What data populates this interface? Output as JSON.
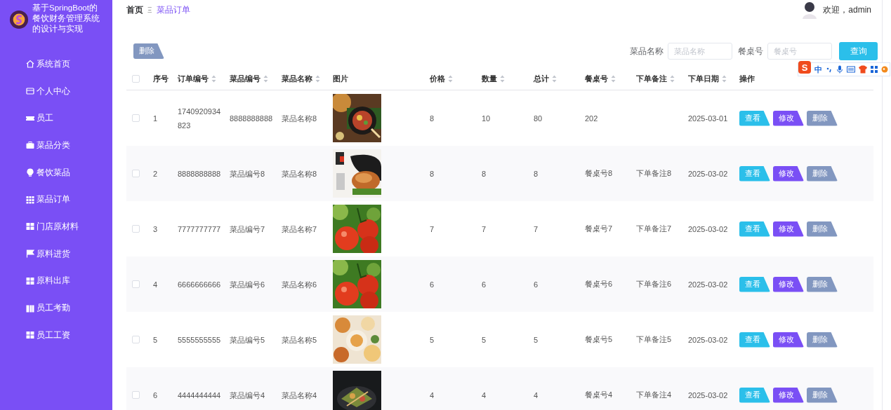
{
  "sidebar": {
    "title": "基于SpringBoot的餐饮财务管理系统的设计与实现",
    "menu": [
      {
        "label": "系统首页"
      },
      {
        "label": "个人中心"
      },
      {
        "label": "员工"
      },
      {
        "label": "菜品分类"
      },
      {
        "label": "餐饮菜品"
      },
      {
        "label": "菜品订单"
      },
      {
        "label": "门店原材料"
      },
      {
        "label": "原料进货"
      },
      {
        "label": "原料出库"
      },
      {
        "label": "员工考勤"
      },
      {
        "label": "员工工资"
      }
    ]
  },
  "breadcrumb": {
    "home": "首页",
    "separator": "Ξ",
    "current": "菜品订单"
  },
  "user": {
    "greeting": "欢迎，admin"
  },
  "toolbar": {
    "delete_button": "删除",
    "filters": [
      {
        "label": "菜品名称",
        "placeholder": "菜品名称"
      },
      {
        "label": "餐桌号",
        "placeholder": "餐桌号"
      }
    ],
    "search_button": "查询"
  },
  "ime": {
    "logo": "S",
    "mode": "中"
  },
  "table": {
    "select_all_checked": false,
    "columns": [
      {
        "label": "序号",
        "sortable": false
      },
      {
        "label": "订单编号",
        "sortable": true
      },
      {
        "label": "菜品编号",
        "sortable": true
      },
      {
        "label": "菜品名称",
        "sortable": true
      },
      {
        "label": "图片",
        "sortable": false
      },
      {
        "label": "价格",
        "sortable": true
      },
      {
        "label": "数量",
        "sortable": true
      },
      {
        "label": "总计",
        "sortable": true
      },
      {
        "label": "餐桌号",
        "sortable": true
      },
      {
        "label": "下单备注",
        "sortable": true
      },
      {
        "label": "下单日期",
        "sortable": true
      },
      {
        "label": "操作",
        "sortable": false
      }
    ],
    "rows": [
      {
        "checked": false,
        "index": "1",
        "order_no": "1740920934823",
        "dish_no": "8888888888",
        "dish_name": "菜品名称8",
        "price": "8",
        "quantity": "10",
        "total": "80",
        "table_no": "202",
        "order_date": "2025-03-01",
        "actions": [
          "查看",
          "修改",
          "删除"
        ]
      },
      {
        "checked": false,
        "index": "2",
        "order_no": "8888888888",
        "dish_no": "菜品编号8",
        "dish_name": "菜品名称8",
        "price": "8",
        "quantity": "8",
        "total": "8",
        "table_no": "餐桌号8",
        "remark": "下单备注8",
        "order_date": "2025-03-02",
        "actions": [
          "查看",
          "修改",
          "删除"
        ]
      },
      {
        "checked": false,
        "index": "3",
        "order_no": "7777777777",
        "dish_no": "菜品编号7",
        "dish_name": "菜品名称7",
        "price": "7",
        "quantity": "7",
        "total": "7",
        "table_no": "餐桌号7",
        "remark": "下单备注7",
        "order_date": "2025-03-02",
        "actions": [
          "查看",
          "修改",
          "删除"
        ]
      },
      {
        "checked": false,
        "index": "4",
        "order_no": "6666666666",
        "dish_no": "菜品编号6",
        "dish_name": "菜品名称6",
        "price": "6",
        "quantity": "6",
        "total": "6",
        "table_no": "餐桌号6",
        "remark": "下单备注6",
        "order_date": "2025-03-02",
        "actions": [
          "查看",
          "修改",
          "删除"
        ]
      },
      {
        "checked": false,
        "index": "5",
        "order_no": "5555555555",
        "dish_no": "菜品编号5",
        "dish_name": "菜品名称5",
        "price": "5",
        "quantity": "5",
        "total": "5",
        "table_no": "餐桌号5",
        "remark": "下单备注5",
        "order_date": "2025-03-02",
        "actions": [
          "查看",
          "修改",
          "删除"
        ]
      },
      {
        "checked": false,
        "index": "6",
        "order_no": "4444444444",
        "dish_no": "菜品编号4",
        "dish_name": "菜品名称4",
        "price": "4",
        "quantity": "4",
        "total": "4",
        "table_no": "餐桌号4",
        "remark": "下单备注4",
        "order_date": "2025-03-02",
        "actions": [
          "查看",
          "修改",
          "删除"
        ]
      }
    ]
  }
}
